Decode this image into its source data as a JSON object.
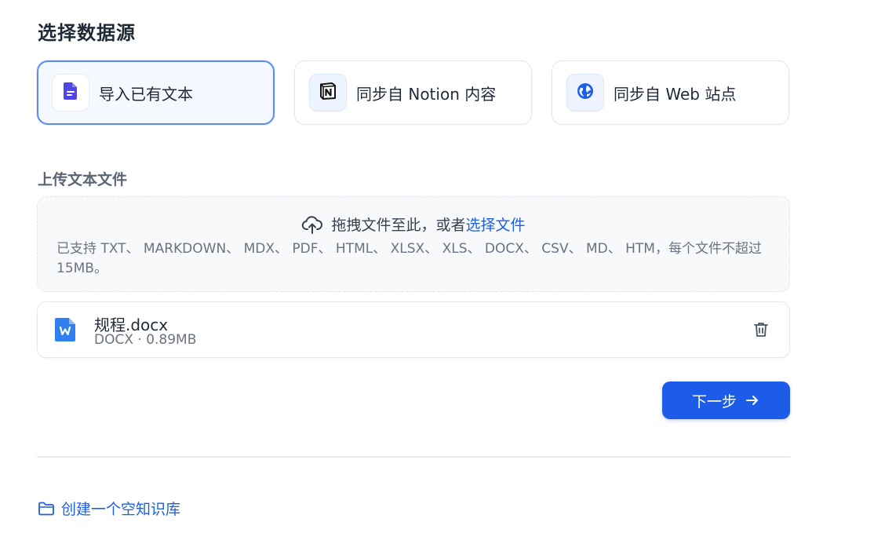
{
  "title": "选择数据源",
  "sources": [
    {
      "label": "导入已有文本",
      "icon": "document-icon",
      "active": true
    },
    {
      "label": "同步自 Notion 内容",
      "icon": "notion-icon",
      "active": false
    },
    {
      "label": "同步自 Web 站点",
      "icon": "web-globe-icon",
      "active": false
    }
  ],
  "upload": {
    "section_label": "上传文本文件",
    "drop_text": "拖拽文件至此，或者 ",
    "select_link": "选择文件",
    "hint": "已支持 TXT、 MARKDOWN、 MDX、 PDF、 HTML、 XLSX、 XLS、 DOCX、 CSV、 MD、 HTM，每个文件不超过 15MB。"
  },
  "file": {
    "name": "规程.docx",
    "meta": "DOCX · 0.89MB",
    "icon": "word-doc-icon"
  },
  "next_label": "下一步",
  "create_link_label": "创建一个空知识库",
  "colors": {
    "accent": "#1c5ce8",
    "active_border": "#5b8def",
    "active_bg": "#f5f8ff",
    "link": "#1d5fe8"
  }
}
